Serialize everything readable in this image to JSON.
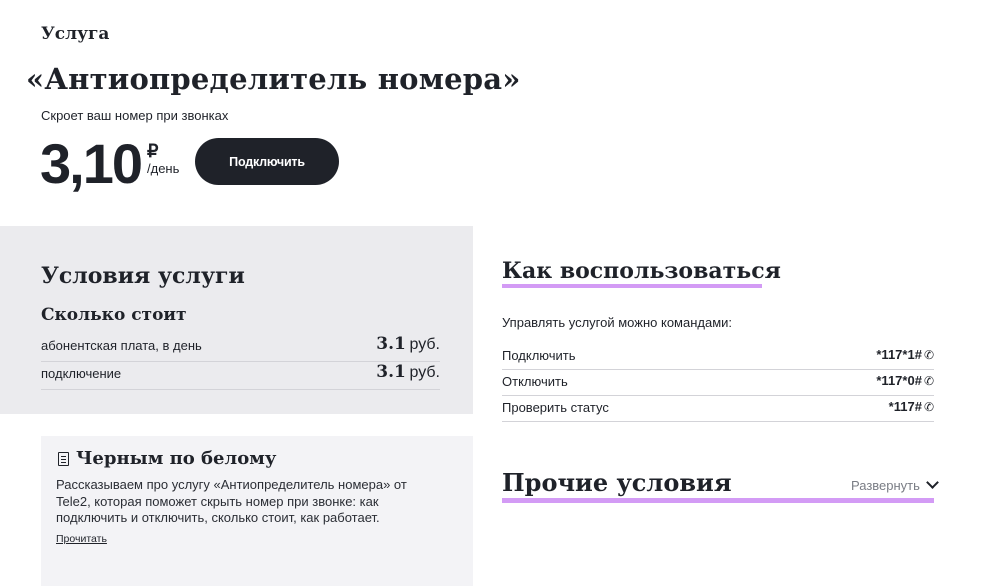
{
  "header": {
    "eyebrow": "Услуга",
    "title": "«Антиопределитель номера»",
    "subtitle": "Скроет ваш номер при звонках",
    "price": "3,10",
    "currency": "₽",
    "period": "/день",
    "connect_label": "Подключить"
  },
  "conditions": {
    "title": "Условия услуги",
    "cost_title": "Сколько стоит",
    "rows": [
      {
        "label": "абонентская плата, в день",
        "value": "3.1",
        "unit": "руб."
      },
      {
        "label": "подключение",
        "value": "3.1",
        "unit": "руб."
      }
    ]
  },
  "black_white": {
    "title": "Черным по белому",
    "text": "Рассказываем про услугу «Антиопределитель номера» от Tele2, которая поможет скрыть номер при звонке: как подключить и отключить, сколько стоит, как работает.",
    "link": "Прочитать"
  },
  "how_to": {
    "title": "Как воспользоваться",
    "intro": "Управлять услугой можно командами:",
    "commands": [
      {
        "label": "Подключить",
        "code": "*117*1#"
      },
      {
        "label": "Отключить",
        "code": "*117*0#"
      },
      {
        "label": "Проверить статус",
        "code": "*117#"
      }
    ]
  },
  "other": {
    "title": "Прочие условия",
    "expand_label": "Развернуть"
  },
  "colors": {
    "accent_underline": "#d39bf5",
    "dark": "#1f2229",
    "panel_grey": "#ebebee"
  },
  "icons": [
    "phone-icon",
    "document-icon",
    "chevron-down-icon"
  ]
}
